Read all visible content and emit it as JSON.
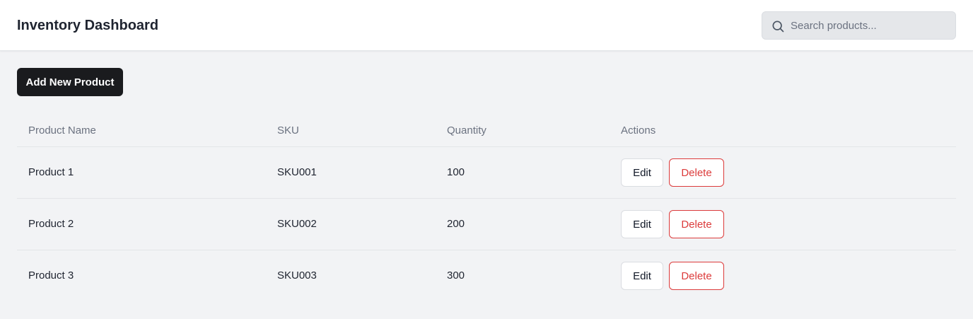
{
  "header": {
    "title": "Inventory Dashboard",
    "search": {
      "placeholder": "Search products...",
      "value": "",
      "icon": "search-icon"
    }
  },
  "toolbar": {
    "add_label": "Add New Product"
  },
  "table": {
    "columns": [
      "Product Name",
      "SKU",
      "Quantity",
      "Actions"
    ],
    "rows": [
      {
        "name": "Product 1",
        "sku": "SKU001",
        "quantity": "100",
        "edit_label": "Edit",
        "delete_label": "Delete"
      },
      {
        "name": "Product 2",
        "sku": "SKU002",
        "quantity": "200",
        "edit_label": "Edit",
        "delete_label": "Delete"
      },
      {
        "name": "Product 3",
        "sku": "SKU003",
        "quantity": "300",
        "edit_label": "Edit",
        "delete_label": "Delete"
      }
    ]
  },
  "colors": {
    "primary_button": "#1a1b1e",
    "danger": "#dc3b3b",
    "background": "#f2f3f5",
    "header_bg": "#ffffff"
  }
}
